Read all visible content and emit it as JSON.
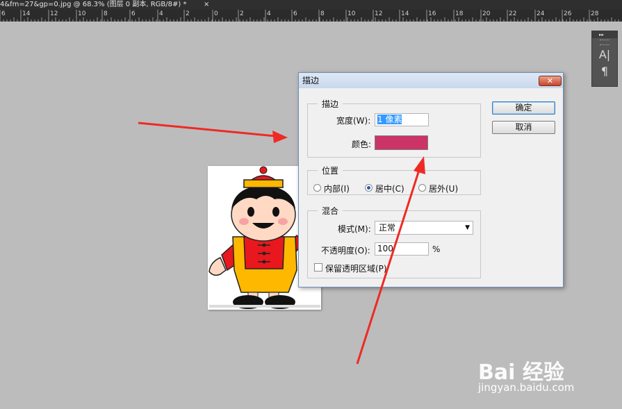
{
  "document_tab": {
    "title": "4&fm=27&gp=0.jpg @ 68.3% (图层 0 副本, RGB/8#) *",
    "close": "×"
  },
  "ruler": {
    "labels": [
      "6",
      "14",
      "12",
      "10",
      "8",
      "6",
      "4",
      "2",
      "0",
      "2",
      "4",
      "6",
      "8",
      "10",
      "12",
      "14",
      "16",
      "18",
      "20",
      "22",
      "24",
      "26",
      "28"
    ]
  },
  "mini_panel": {
    "header": "▸▸",
    "character_icon": "A|",
    "paragraph_icon": "¶"
  },
  "dialog": {
    "title": "描边",
    "close": "✕",
    "ok_label": "确定",
    "cancel_label": "取消",
    "stroke_group": {
      "legend": "描边",
      "width_label": "宽度(W):",
      "width_value": "1 像素",
      "color_label": "颜色:",
      "color_value": "#cc3366"
    },
    "position_group": {
      "legend": "位置",
      "inside": "内部(I)",
      "center": "居中(C)",
      "outside": "居外(U)",
      "selected": "center"
    },
    "blend_group": {
      "legend": "混合",
      "mode_label": "模式(M):",
      "mode_value": "正常",
      "opacity_label": "不透明度(O):",
      "opacity_value": "100",
      "opacity_unit": "%",
      "preserve_label": "保留透明区域(P)",
      "preserve_checked": false
    }
  },
  "annotation_color": "#ee2a24",
  "watermark": {
    "logo": "Bai 经验",
    "url": "jingyan.baidu.com"
  }
}
